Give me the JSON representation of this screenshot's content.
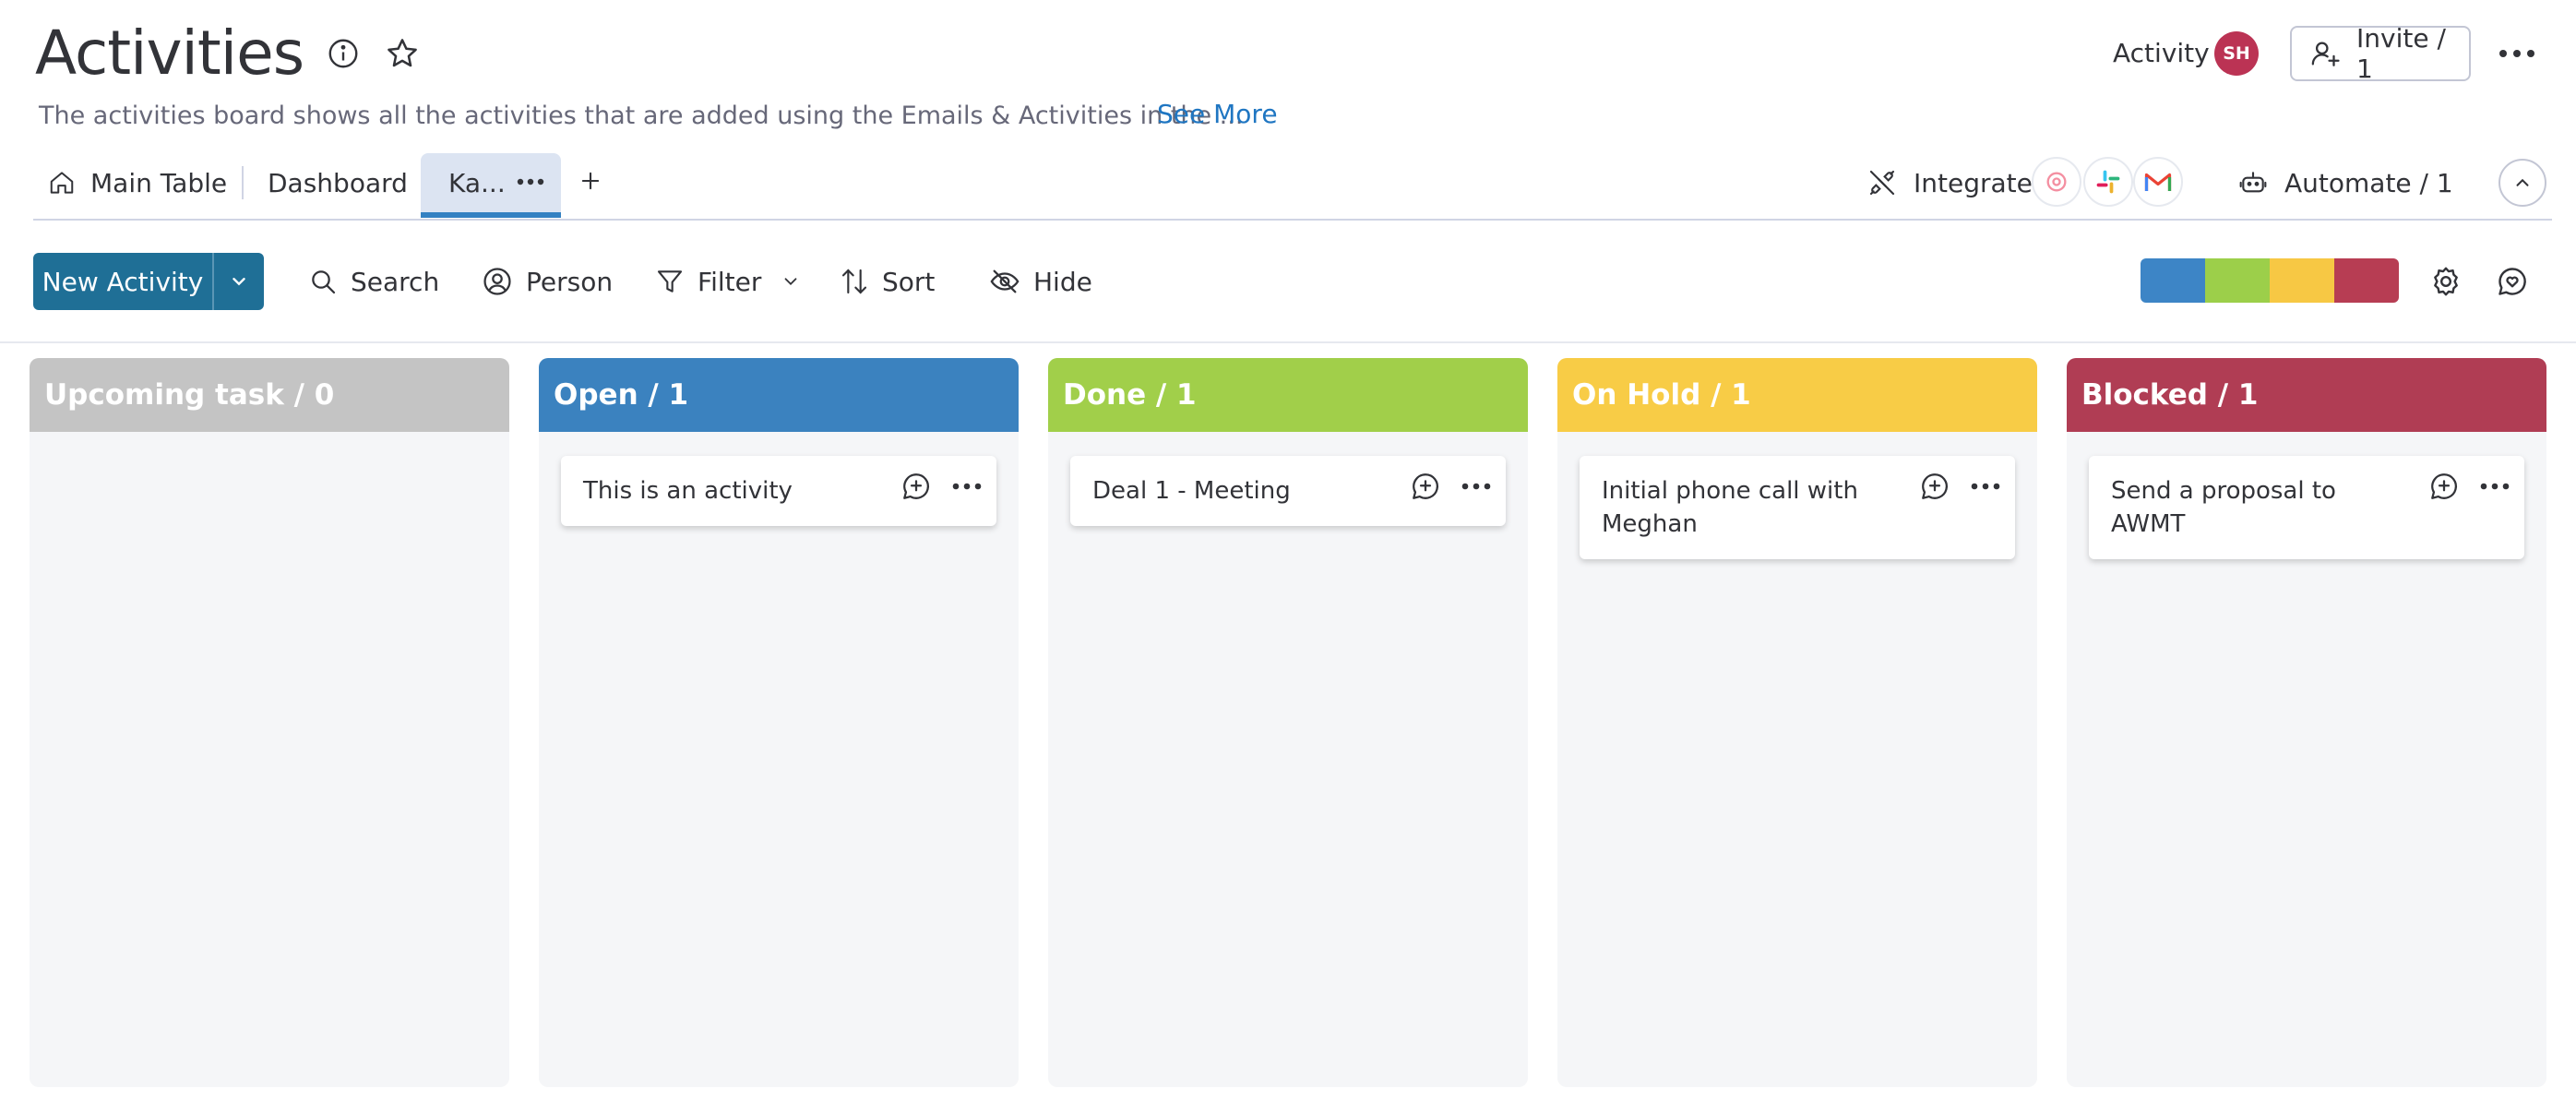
{
  "header": {
    "title": "Activities",
    "description": "The activities board shows all the activities that are added using the Emails & Activities in the ...",
    "see_more": "See More",
    "activity_label": "Activity",
    "avatar_initials": "SH",
    "invite_label": "Invite / 1"
  },
  "tabs": {
    "main_table": "Main Table",
    "dashboard": "Dashboard",
    "kanban": "Ka...",
    "integrate": "Integrate",
    "automate": "Automate / 1"
  },
  "toolbar": {
    "new_activity": "New Activity",
    "search": "Search",
    "person": "Person",
    "filter": "Filter",
    "sort": "Sort",
    "hide": "Hide",
    "status_colors": [
      "#3d85c6",
      "#9ccf4a",
      "#f7c844",
      "#b73d53"
    ]
  },
  "columns": [
    {
      "title": "Upcoming task / 0",
      "color": "#c4c4c4",
      "cards": []
    },
    {
      "title": "Open / 1",
      "color": "#3b82bf",
      "cards": [
        "This is an activity"
      ]
    },
    {
      "title": "Done / 1",
      "color": "#a1cf4a",
      "cards": [
        "Deal 1 - Meeting"
      ]
    },
    {
      "title": "On Hold / 1",
      "color": "#f8cc46",
      "cards": [
        "Initial phone call with Meghan"
      ]
    },
    {
      "title": "Blocked / 1",
      "color": "#b03d54",
      "cards": [
        "Send a proposal to AWMT"
      ]
    }
  ]
}
